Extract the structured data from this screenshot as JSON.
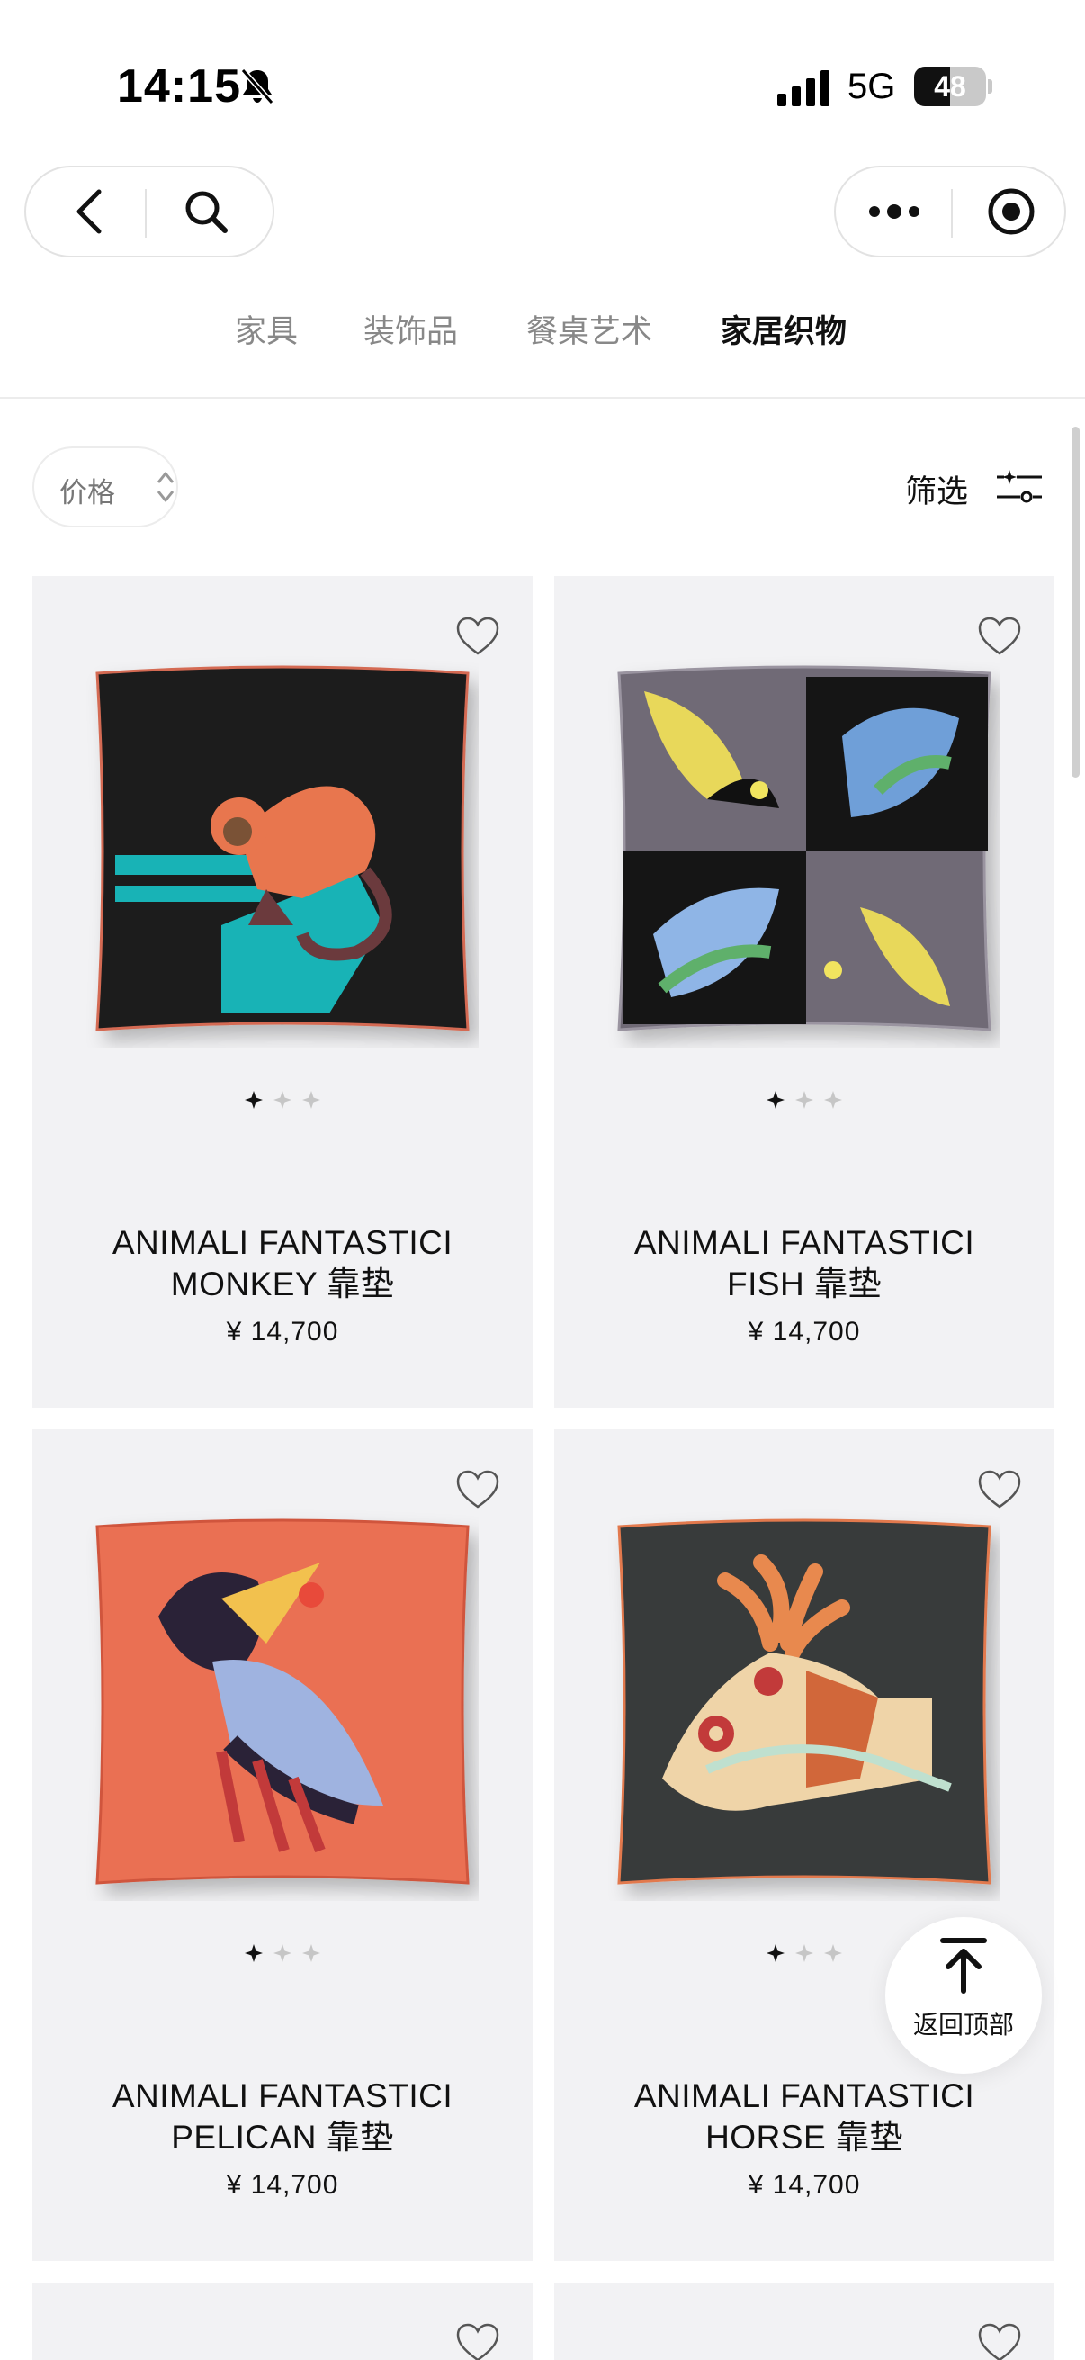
{
  "status_bar": {
    "time": "14:15",
    "network": "5G",
    "battery": "48"
  },
  "icons": {
    "back": "chevron-left-icon",
    "search": "search-icon",
    "more": "more-dots-icon",
    "record": "target-icon",
    "mute": "bell-slash-icon",
    "favorite": "heart-icon",
    "filter": "sliders-icon",
    "sort": "sort-arrows-icon",
    "top": "arrow-up-to-top-icon"
  },
  "tabs": [
    {
      "label": "家具"
    },
    {
      "label": "装饰品"
    },
    {
      "label": "餐桌艺术"
    },
    {
      "label": "家居织物",
      "active": true
    }
  ],
  "filters": {
    "price_label": "价格",
    "filter_label": "筛选"
  },
  "products": [
    {
      "name_line1": "ANIMALI FANTASTICI",
      "name_line2": "MONKEY 靠垫",
      "price": "¥ 14,700",
      "pillow_color": "#1e1c1f"
    },
    {
      "name_line1": "ANIMALI FANTASTICI",
      "name_line2": "FISH 靠垫",
      "price": "¥ 14,700",
      "pillow_color": "#6f6a76"
    },
    {
      "name_line1": "ANIMALI FANTASTICI",
      "name_line2": "PELICAN 靠垫",
      "price": "¥ 14,700",
      "pillow_color": "#ea7053"
    },
    {
      "name_line1": "ANIMALI FANTASTICI",
      "name_line2": "HORSE 靠垫",
      "price": "¥ 14,700",
      "pillow_color": "#383a3a"
    }
  ],
  "back_to_top": {
    "label": "返回顶部"
  },
  "colors": {
    "card_bg": "#f2f2f4",
    "active_tab": "#111111",
    "inactive_tab": "#888888"
  }
}
